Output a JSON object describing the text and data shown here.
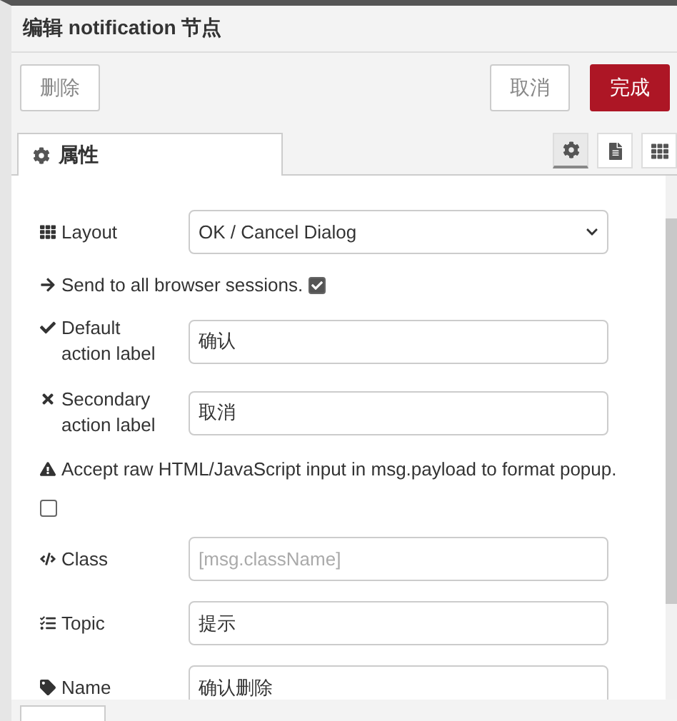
{
  "title": "编辑 notification 节点",
  "buttons": [
    {
      "label": "删除",
      "kind": "plain"
    },
    {
      "label": "取消",
      "kind": "plain"
    },
    {
      "label": "完成",
      "kind": "primary"
    }
  ],
  "tabs": [
    {
      "label": "属性",
      "selected": true
    }
  ],
  "side_tabs": [
    {
      "selected": true
    },
    {
      "selected": false
    },
    {
      "selected": false
    }
  ],
  "fields": [
    {
      "kind": "select",
      "label": "Layout",
      "value": "OK / Cancel Dialog"
    },
    {
      "kind": "check-inline",
      "label": "Send to all browser sessions.",
      "checked": true
    },
    {
      "kind": "text",
      "label": "Default action label",
      "value": "确认"
    },
    {
      "kind": "text",
      "label": "Secondary action label",
      "value": "取消"
    },
    {
      "kind": "check-below",
      "label": "Accept raw HTML/JavaScript input in msg.payload to format popup.",
      "checked": false
    },
    {
      "kind": "text",
      "label": "Class",
      "placeholder": "[msg.className]"
    },
    {
      "kind": "text",
      "label": "Topic",
      "value": "提示"
    },
    {
      "kind": "text",
      "label": "Name",
      "value": "确认删除"
    }
  ]
}
